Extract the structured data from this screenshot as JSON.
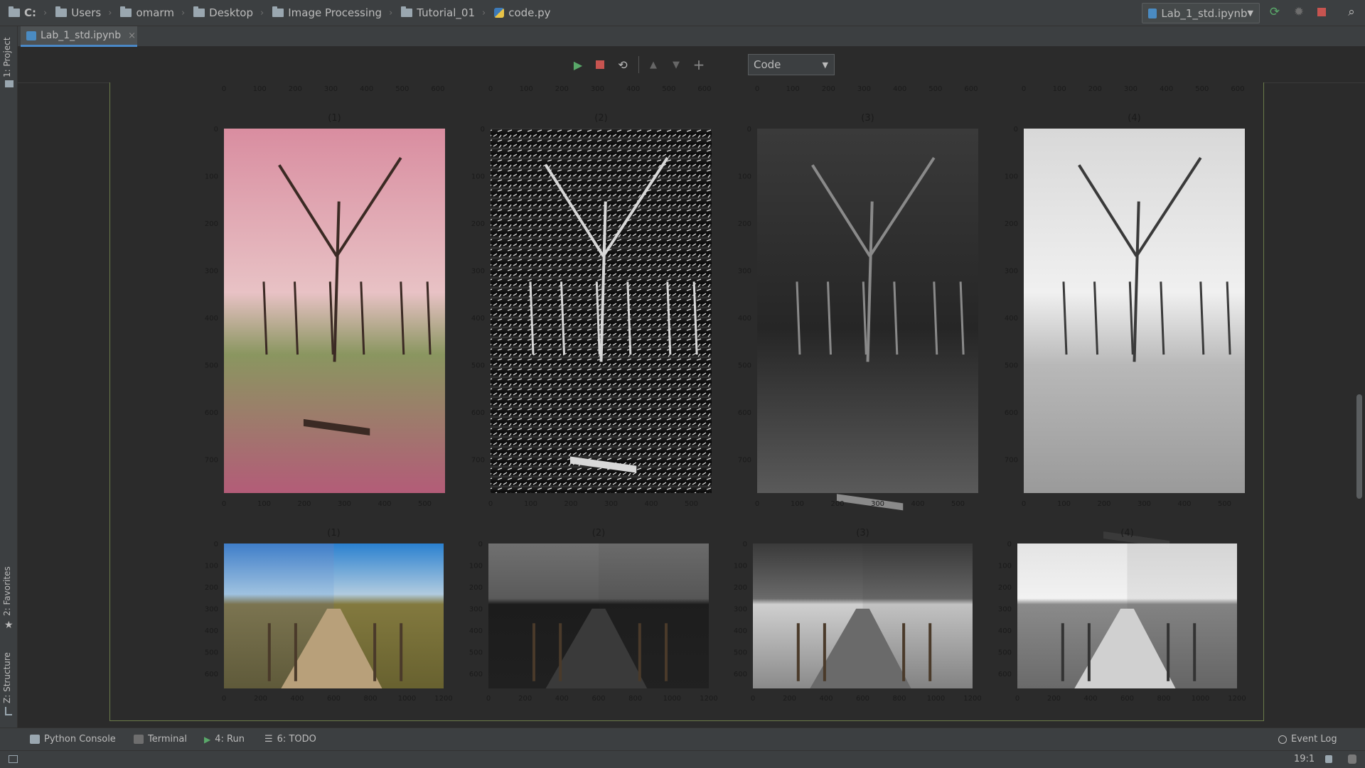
{
  "breadcrumbs": [
    {
      "label": "C:",
      "bold": true
    },
    {
      "label": "Users"
    },
    {
      "label": "omarm"
    },
    {
      "label": "Desktop"
    },
    {
      "label": "Image Processing"
    },
    {
      "label": "Tutorial_01"
    },
    {
      "label": "code.py",
      "icon": "python-file-icon"
    }
  ],
  "run_config": {
    "label": "Lab_1_std.ipynb"
  },
  "left_strip": {
    "project": "1: Project",
    "favorites": "2: Favorites",
    "structure": "Z: Structure"
  },
  "editor_tab": {
    "label": "Lab_1_std.ipynb",
    "close": "×"
  },
  "toolbar": {
    "cell_type": "Code"
  },
  "figure_rows": [
    {
      "panel_titles": [
        "(1)",
        "(2)",
        "(3)",
        "(4)"
      ],
      "top_ticks": [
        "0",
        "100",
        "200",
        "300",
        "400",
        "500",
        "600"
      ],
      "x_ticks": [
        "0",
        "100",
        "200",
        "300",
        "400",
        "500"
      ],
      "y_ticks": [
        "0",
        "100",
        "200",
        "300",
        "400",
        "500",
        "600",
        "700"
      ],
      "descriptions": [
        "pink cherry blossom park with bench",
        "binary thresholded edges",
        "dark gray channel",
        "light grayscale"
      ]
    },
    {
      "panel_titles": [
        "(1)",
        "(2)",
        "(3)",
        "(4)"
      ],
      "x_ticks": [
        "0",
        "200",
        "400",
        "600",
        "800",
        "1000",
        "1200"
      ],
      "y_ticks": [
        "0",
        "100",
        "200",
        "300",
        "400",
        "500",
        "600"
      ],
      "descriptions": [
        "boardwalk through dunes split comparison",
        "dark grayscale",
        "high contrast grayscale",
        "light grayscale"
      ]
    }
  ],
  "bottom_tools": [
    {
      "label": "Python Console",
      "icon": "python-console-icon"
    },
    {
      "label": "Terminal",
      "icon": "terminal-icon"
    },
    {
      "label": "4: Run",
      "icon": "run-icon"
    },
    {
      "label": "6: TODO",
      "icon": "todo-icon"
    }
  ],
  "event_log": {
    "label": "Event Log"
  },
  "status": {
    "position": "19:1"
  },
  "colors": {
    "accent": "#4a88c7",
    "run_green": "#59a869",
    "stop_red": "#c75450",
    "cell_border": "#6b7b4a"
  }
}
